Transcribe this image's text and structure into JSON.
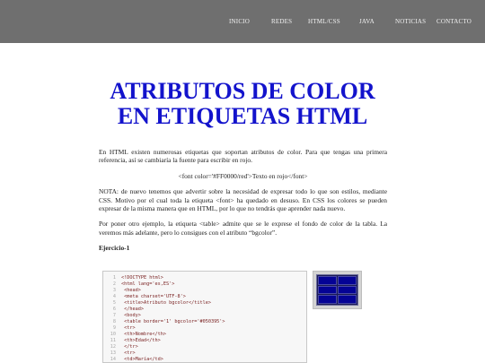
{
  "nav": {
    "items": [
      "INICIO",
      "REDES",
      "HTML/CSS",
      "JAVA",
      "NOTICIAS",
      "CONTACTO"
    ]
  },
  "title_line1": "ATRIBUTOS DE COLOR",
  "title_line2": "EN ETIQUETAS HTML",
  "paragraphs": {
    "p1": "En HTML existen numerosas etiquetas que soportan atributos de color. Para que tengas una primera referencia, así se cambiaría la fuente para escribir en rojo.",
    "code_example": "<font color='#FF0000/red'>Texto en rojo</font>",
    "p2": "NOTA: de nuevo tenemos que advertir sobre la necesidad de expresar todo lo que son estilos, mediante CSS. Motivo por el cual toda la etiqueta <font> ha quedado en desuso. En CSS los colores se pueden expresar de la misma manera que en HTML, por lo que no tendrás que aprender nada nuevo.",
    "p3": "Por poner otro ejemplo, la etiqueta <table> admite que se le exprese el fondo de color de la tabla. La veremos más adelante, pero lo consigues con el atributo “bgcolor”.",
    "exercise_heading": "Ejercicio-1"
  },
  "code_lines": [
    {
      "n": "1",
      "text": "<!DOCTYPE html>"
    },
    {
      "n": "2",
      "text": "<html lang='es,ES'>"
    },
    {
      "n": "3",
      "text": "    <head>"
    },
    {
      "n": "4",
      "text": "        <meta charset='UTF-8'>"
    },
    {
      "n": "5",
      "text": "        <title>Atributo bgcolor</title>"
    },
    {
      "n": "6",
      "text": "    </head>"
    },
    {
      "n": "7",
      "text": "    <body>"
    },
    {
      "n": "8",
      "text": "        <table border='1' bgcolor='#050395'>"
    },
    {
      "n": "9",
      "text": "            <tr>"
    },
    {
      "n": "10",
      "text": "                <th>Nombre</th>"
    },
    {
      "n": "11",
      "text": "                <th>Edad</th>"
    },
    {
      "n": "12",
      "text": "            </tr>"
    },
    {
      "n": "13",
      "text": "            <tr>"
    },
    {
      "n": "14",
      "text": "                <td>María</td>"
    }
  ],
  "colors": {
    "topbar": "#6f6f6f",
    "title": "#1313cc",
    "table_bg": "#050395"
  }
}
